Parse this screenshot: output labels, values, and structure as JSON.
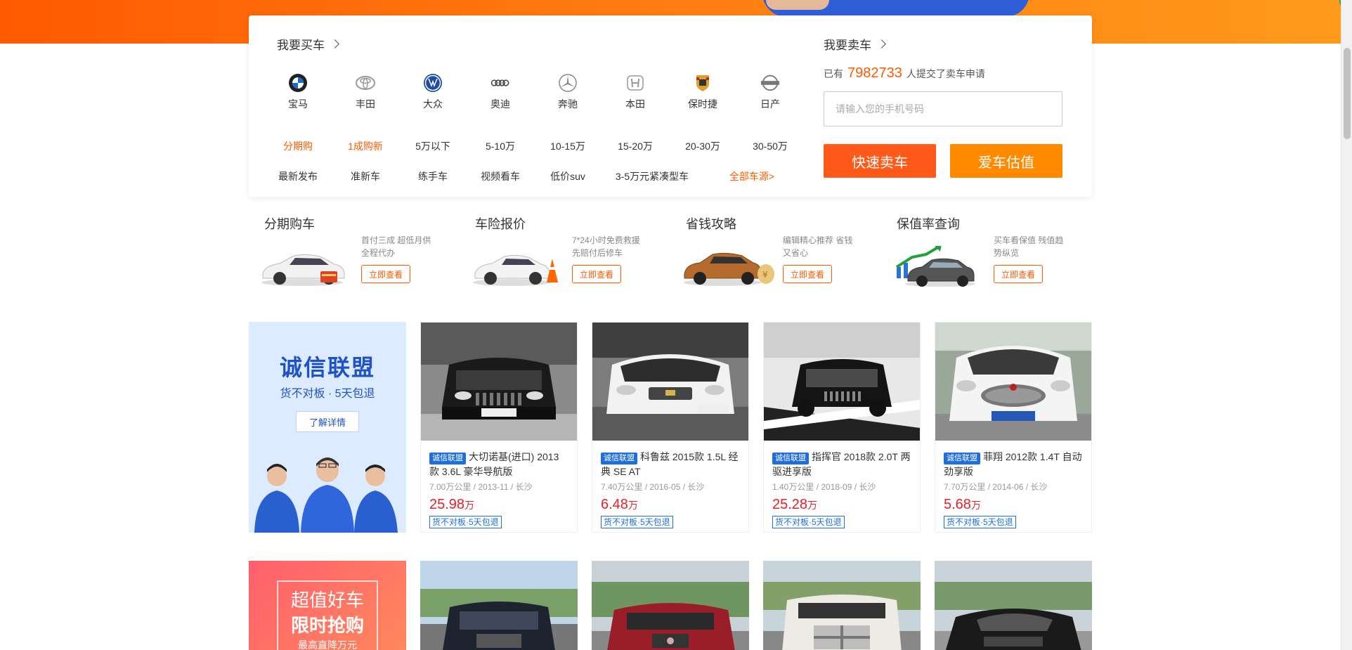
{
  "buy": {
    "title": "我要买车",
    "brands": [
      {
        "name": "宝马",
        "icon": "bmw-logo-icon",
        "color": "#1c69d4"
      },
      {
        "name": "丰田",
        "icon": "toyota-logo-icon",
        "color": "#999999"
      },
      {
        "name": "大众",
        "icon": "volkswagen-logo-icon",
        "color": "#1e4da0"
      },
      {
        "name": "奥迪",
        "icon": "audi-logo-icon",
        "color": "#555555"
      },
      {
        "name": "奔驰",
        "icon": "mercedes-logo-icon",
        "color": "#888888"
      },
      {
        "name": "本田",
        "icon": "honda-logo-icon",
        "color": "#999999"
      },
      {
        "name": "保时捷",
        "icon": "porsche-logo-icon",
        "color": "#b5831c"
      },
      {
        "name": "日产",
        "icon": "nissan-logo-icon",
        "color": "#777777"
      }
    ],
    "row1": [
      "分期购",
      "1成购新",
      "5万以下",
      "5-10万",
      "10-15万",
      "15-20万",
      "20-30万",
      "30-50万"
    ],
    "row2": [
      "最新发布",
      "准新车",
      "练手车",
      "视频看车",
      "低价suv",
      "3-5万元紧凑型车",
      "全部车源>"
    ]
  },
  "sell": {
    "title": "我要卖车",
    "count_prefix": "已有",
    "count": "7982733",
    "count_suffix": "人提交了卖车申请",
    "phone_placeholder": "请输入您的手机号码",
    "quick_sell_label": "快速卖车",
    "estimate_label": "爱车估值"
  },
  "services": [
    {
      "title": "分期购车",
      "desc": "首付三成  超低月供 全程代办",
      "button": "立即查看"
    },
    {
      "title": "车险报价",
      "desc": "7*24小时免费救援 先赔付后修车",
      "button": "立即查看"
    },
    {
      "title": "省钱攻略",
      "desc": "编辑精心推荐 省钱又省心",
      "button": "立即查看"
    },
    {
      "title": "保值率查询",
      "desc": "买车看保值 残值趋势纵览",
      "button": "立即查看"
    }
  ],
  "promo_alliance": {
    "title": "诚信联盟",
    "subtitle": "货不对板 · 5天包退",
    "button": "了解详情"
  },
  "cars": [
    {
      "tag": "诚信联盟",
      "title": "大切诺基(进口) 2013款 3.6L 豪华导航版",
      "meta": "7.00万公里 / 2013-11 / 长沙",
      "price": "25.98",
      "unit": "万",
      "guarantee": "货不对板·5天包退"
    },
    {
      "tag": "诚信联盟",
      "title": "科鲁兹 2015款 1.5L 经典 SE AT",
      "meta": "7.40万公里 / 2016-05 / 长沙",
      "price": "6.48",
      "unit": "万",
      "guarantee": "货不对板·5天包退"
    },
    {
      "tag": "诚信联盟",
      "title": "指挥官 2018款 2.0T 两驱进享版",
      "meta": "1.40万公里 / 2018-09 / 长沙",
      "price": "25.28",
      "unit": "万",
      "guarantee": "货不对板·5天包退"
    },
    {
      "tag": "诚信联盟",
      "title": "菲翔 2012款 1.4T 自动劲享版",
      "meta": "7.70万公里 / 2014-06 / 长沙",
      "price": "5.68",
      "unit": "万",
      "guarantee": "货不对板·5天包退"
    }
  ],
  "promo_deal": {
    "line1": "超值好车",
    "line2": "限时抢购",
    "line3": "最高直降万元"
  }
}
